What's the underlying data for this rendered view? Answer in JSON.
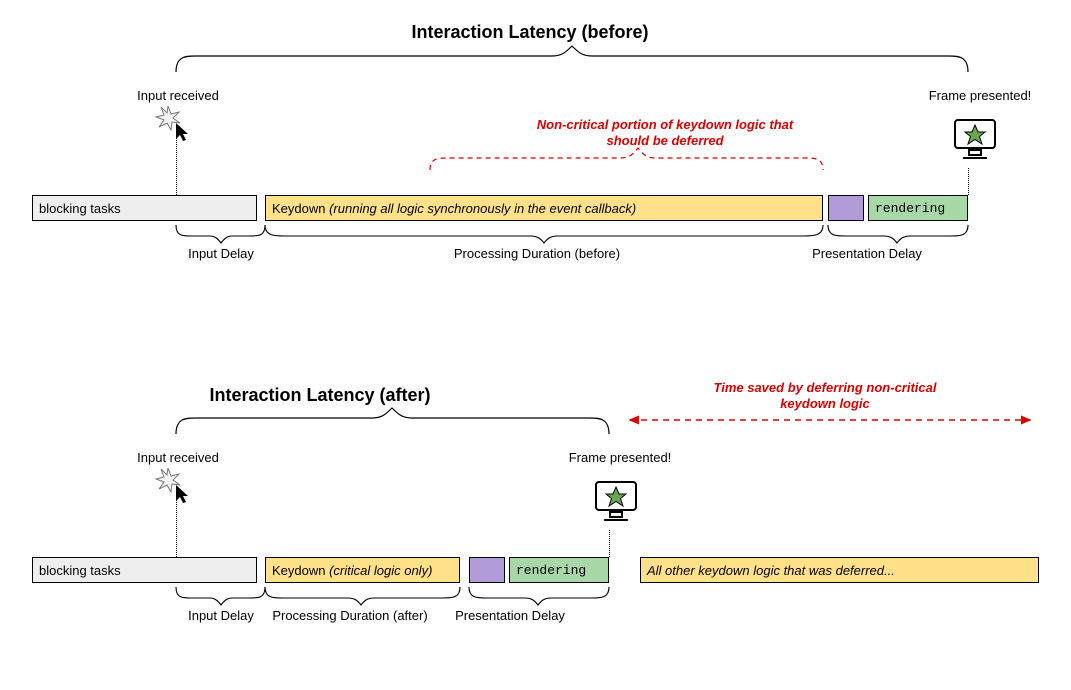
{
  "before": {
    "title": "Interaction Latency (before)",
    "input_received": "Input received",
    "frame_presented": "Frame presented!",
    "deferred_note": "Non-critical portion of keydown logic that should be deferred",
    "segments": {
      "blocking": "blocking tasks",
      "keydown_prefix": "Keydown ",
      "keydown_suffix": "(running all logic synchronously in the event callback)",
      "rendering": "rendering"
    },
    "braces": {
      "input_delay": "Input Delay",
      "processing": "Processing Duration (before)",
      "presentation": "Presentation Delay"
    }
  },
  "after": {
    "title": "Interaction Latency (after)",
    "input_received": "Input received",
    "frame_presented": "Frame presented!",
    "time_saved": "Time saved by deferring non-critical keydown logic",
    "segments": {
      "blocking": "blocking tasks",
      "keydown_prefix": "Keydown ",
      "keydown_suffix": "(critical logic only)",
      "rendering": "rendering",
      "deferred": "All other keydown logic that was deferred..."
    },
    "braces": {
      "input_delay": "Input Delay",
      "processing": "Processing Duration (after)",
      "presentation": "Presentation Delay"
    }
  }
}
